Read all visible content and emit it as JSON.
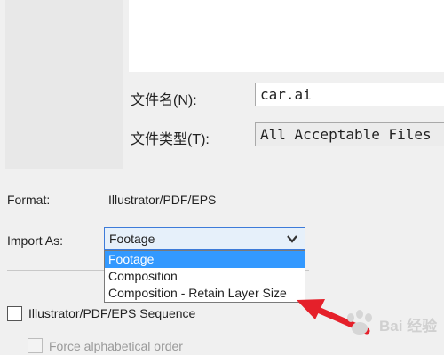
{
  "file_dialog": {
    "filename_label": "文件名(N):",
    "filename_value": "car.ai",
    "filetype_label": "文件类型(T):",
    "filetype_value": "All Acceptable Files"
  },
  "import_options": {
    "format_label": "Format:",
    "format_value": "Illustrator/PDF/EPS",
    "import_as_label": "Import As:",
    "import_as_value": "Footage",
    "import_as_options": [
      "Footage",
      "Composition",
      "Composition - Retain Layer Size"
    ],
    "sequence_label": "Illustrator/PDF/EPS Sequence",
    "alphabetical_label": "Force alphabetical order"
  },
  "colors": {
    "selection": "#3399ff",
    "arrow": "#e5202a"
  },
  "icons": {
    "dropdown": "chevron-down-icon",
    "annotation": "red-arrow-icon",
    "watermark": "baidu-paw-logo"
  },
  "watermark": {
    "text": "Bai 经验"
  }
}
